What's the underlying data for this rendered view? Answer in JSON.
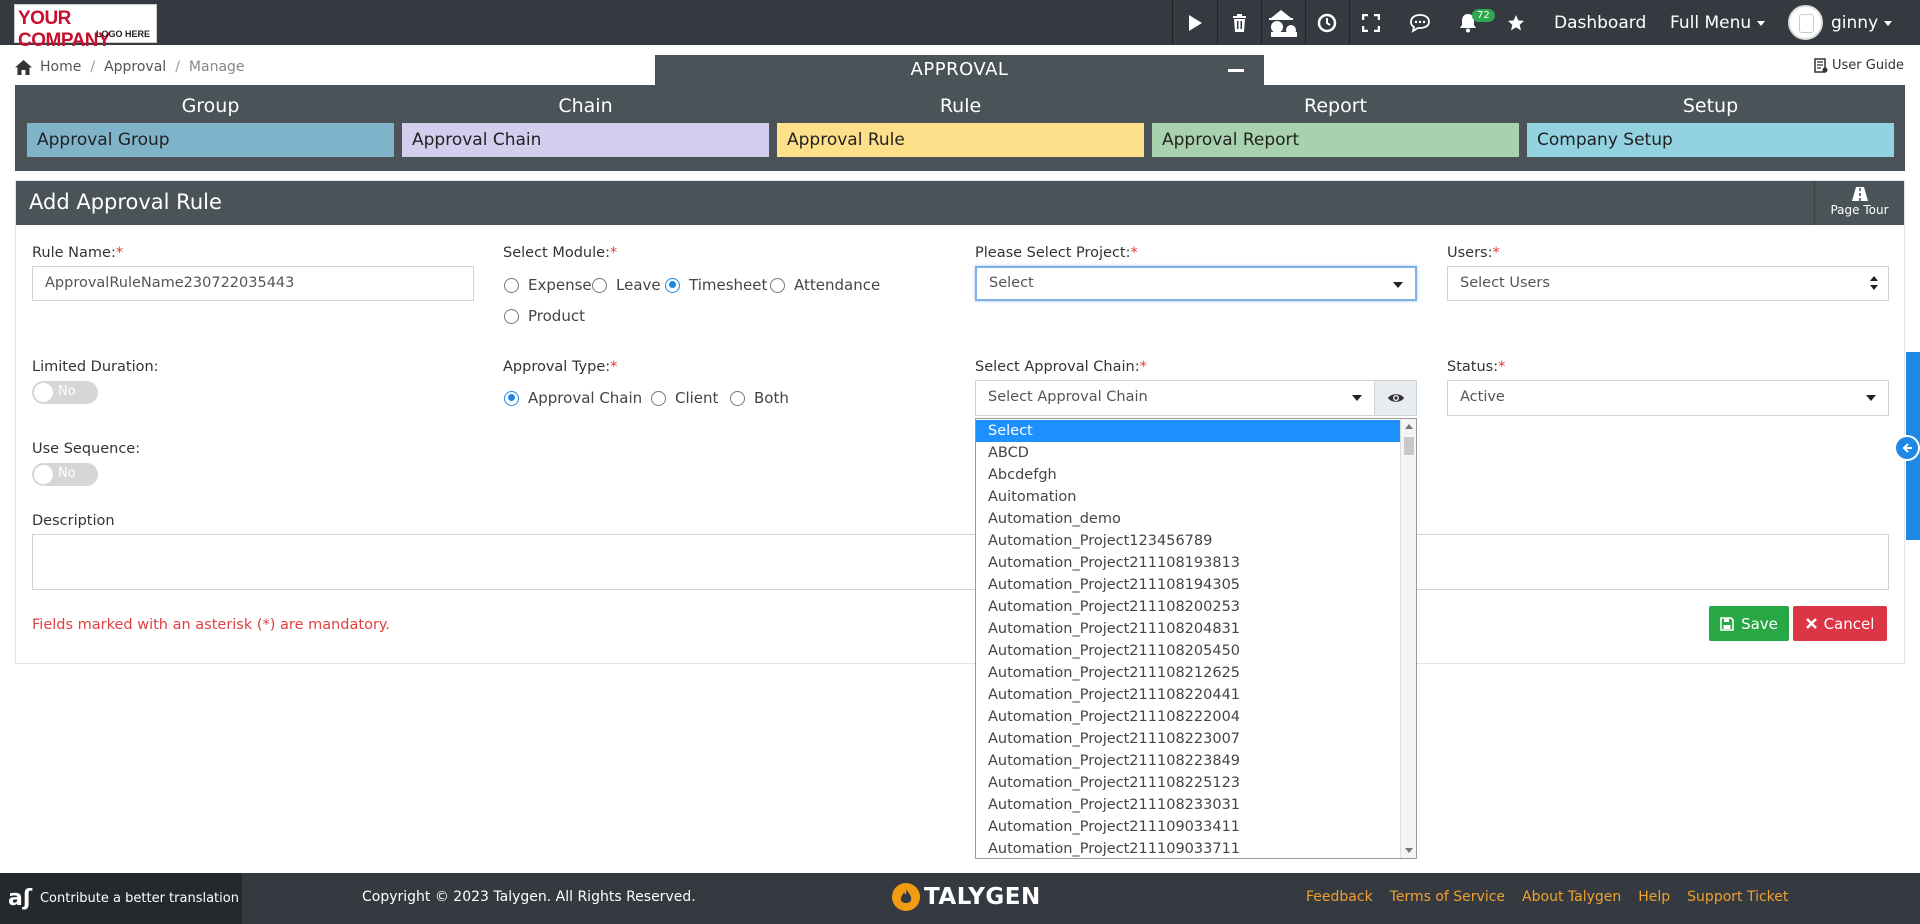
{
  "logo": {
    "line1": "YOUR COMPANY",
    "line2": "LOGO HERE"
  },
  "topbar": {
    "notification_count": "72",
    "dashboard_label": "Dashboard",
    "full_menu_label": "Full Menu",
    "user_name": "ginny"
  },
  "breadcrumb": {
    "home": "Home",
    "approval": "Approval",
    "manage": "Manage",
    "sep": "/"
  },
  "user_guide": "User Guide",
  "approval_panel": {
    "title": "APPROVAL",
    "columns": [
      {
        "heading": "Group",
        "item": "Approval Group",
        "color": "#7fb3c9"
      },
      {
        "heading": "Chain",
        "item": "Approval Chain",
        "color": "#d3cdee"
      },
      {
        "heading": "Rule",
        "item": "Approval Rule",
        "color": "#ffe08a"
      },
      {
        "heading": "Report",
        "item": "Approval Report",
        "color": "#a8d2ad"
      },
      {
        "heading": "Setup",
        "item": "Company Setup",
        "color": "#93d2e0"
      }
    ]
  },
  "form": {
    "title": "Add Approval Rule",
    "page_tour": "Page Tour",
    "required_mark": "*",
    "rule_name": {
      "label": "Rule Name:",
      "value": "ApprovalRuleName230722035443"
    },
    "module": {
      "label": "Select Module:",
      "options": [
        "Expense",
        "Leave",
        "Timesheet",
        "Attendance",
        "Product"
      ],
      "selected": "Timesheet"
    },
    "project": {
      "label": "Please Select Project:",
      "value": "Select"
    },
    "users": {
      "label": "Users:",
      "value": "Select Users"
    },
    "limited_duration": {
      "label": "Limited Duration:",
      "value": "No"
    },
    "approval_type": {
      "label": "Approval Type:",
      "options": [
        "Approval Chain",
        "Client",
        "Both"
      ],
      "selected": "Approval Chain"
    },
    "approval_chain": {
      "label": "Select Approval Chain:",
      "value": "Select Approval Chain"
    },
    "status": {
      "label": "Status:",
      "value": "Active"
    },
    "use_sequence": {
      "label": "Use Sequence:",
      "value": "No"
    },
    "description": {
      "label": "Description",
      "value": ""
    },
    "mandatory_note": "Fields marked with an asterisk (*) are mandatory.",
    "save_label": "Save",
    "cancel_label": "Cancel"
  },
  "dropdown": {
    "items": [
      "Select",
      "ABCD",
      "Abcdefgh",
      "Auitomation",
      "Automation_demo",
      "Automation_Project123456789",
      "Automation_Project211108193813",
      "Automation_Project211108194305",
      "Automation_Project211108200253",
      "Automation_Project211108204831",
      "Automation_Project211108205450",
      "Automation_Project211108212625",
      "Automation_Project211108220441",
      "Automation_Project211108222004",
      "Automation_Project211108223007",
      "Automation_Project211108223849",
      "Automation_Project211108225123",
      "Automation_Project211108233031",
      "Automation_Project211109033411",
      "Automation_Project211109033711"
    ],
    "selected_index": 0
  },
  "footer": {
    "contribute": "Contribute a better translation",
    "copyright": "Copyright © 2023 Talygen. All Rights Reserved.",
    "brand": "TALYGEN",
    "links": [
      "Feedback",
      "Terms of Service",
      "About Talygen",
      "Help",
      "Support Ticket"
    ]
  }
}
